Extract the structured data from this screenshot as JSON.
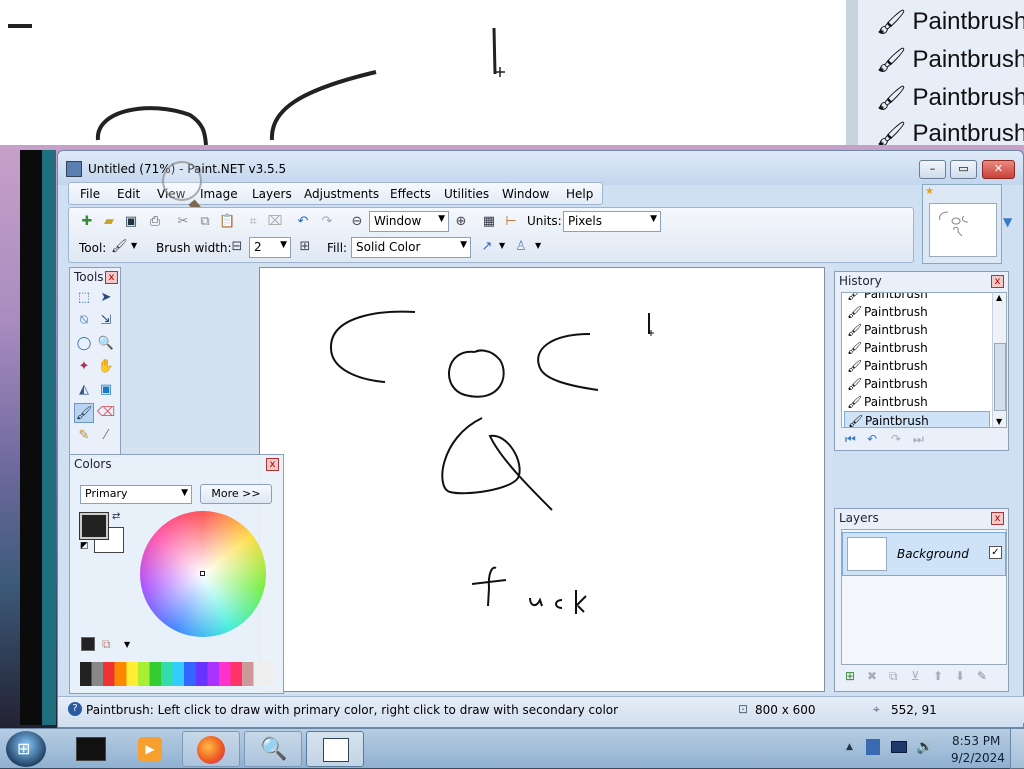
{
  "zoom_view": {
    "history_items": [
      "Paintbrush",
      "Paintbrush",
      "Paintbrush",
      "Paintbrush"
    ]
  },
  "window": {
    "title": "Untitled (71%) - Paint.NET v3.5.5",
    "buttons": {
      "minimize": "–",
      "maximize": "▭",
      "close": "✕"
    }
  },
  "menu": [
    "File",
    "Edit",
    "View",
    "Image",
    "Layers",
    "Adjustments",
    "Effects",
    "Utilities",
    "Window",
    "Help"
  ],
  "toolbar": {
    "zoom_value": "Window",
    "units_label": "Units:",
    "units_value": "Pixels",
    "tool_label": "Tool:",
    "brush_width_label": "Brush width:",
    "brush_width_value": "2",
    "fill_label": "Fill:",
    "fill_value": "Solid Color"
  },
  "tools_panel": {
    "title": "Tools",
    "close": "x"
  },
  "colors_panel": {
    "title": "Colors",
    "mode": "Primary",
    "more_button": "More >>",
    "primary_color": "#222222",
    "secondary_color": "#ffffff"
  },
  "history_panel": {
    "title": "History",
    "items": [
      "Paintbrush",
      "Paintbrush",
      "Paintbrush",
      "Paintbrush",
      "Paintbrush",
      "Paintbrush",
      "Paintbrush",
      "Paintbrush"
    ],
    "selected_index": 7
  },
  "layers_panel": {
    "title": "Layers",
    "layers": [
      {
        "name": "Background",
        "visible": true
      }
    ]
  },
  "canvas": {
    "drawn_text": "fuck"
  },
  "status": {
    "hint": "Paintbrush: Left click to draw with primary color, right click to draw with secondary color",
    "image_size": "800 x 600",
    "cursor_pos": "552, 91"
  },
  "taskbar": {
    "time": "8:53 PM",
    "date": "9/2/2024"
  },
  "colors": {
    "window_bg": "#cfe0f3",
    "accent": "#3a78c4",
    "close_red": "#d9534f"
  }
}
